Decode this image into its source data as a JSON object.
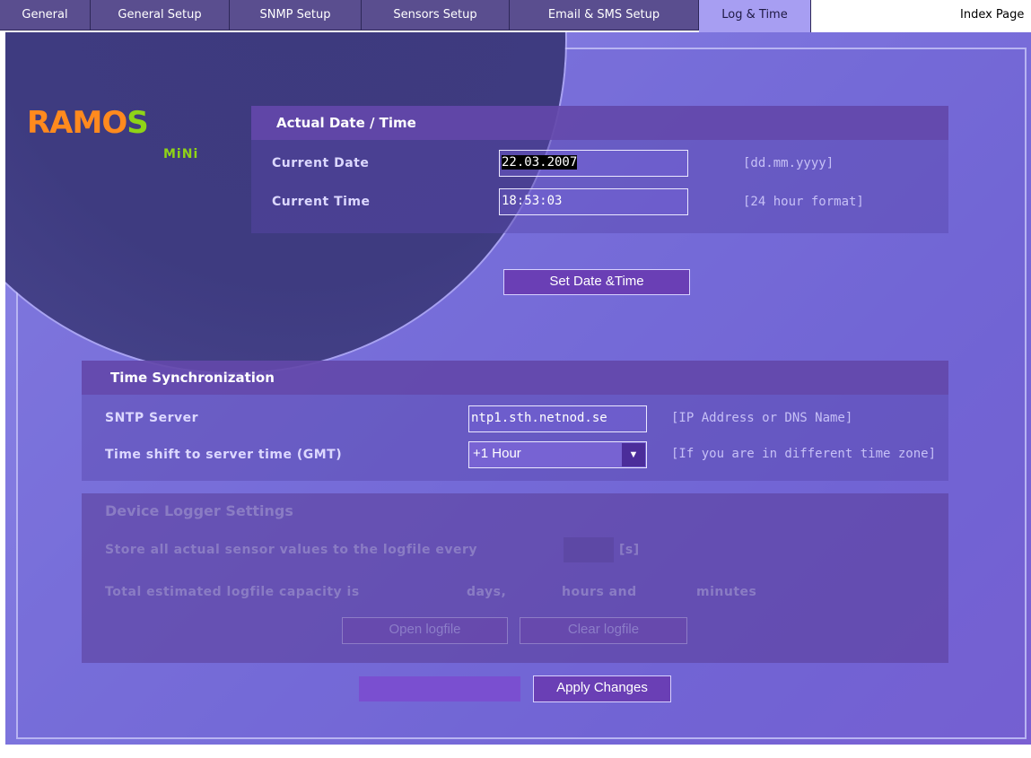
{
  "tabs": [
    {
      "label": "General",
      "active": false
    },
    {
      "label": "General Setup",
      "active": false
    },
    {
      "label": "SNMP Setup",
      "active": false
    },
    {
      "label": "Sensors Setup",
      "active": false
    },
    {
      "label": "Email & SMS Setup",
      "active": false
    },
    {
      "label": "Log & Time",
      "active": true
    }
  ],
  "index_link": "Index Page",
  "logo": {
    "main_part1": "RAMO",
    "main_part2": "S",
    "sub": "MiNi"
  },
  "datetime": {
    "title": "Actual Date / Time",
    "date_label": "Current Date",
    "date_value": "22.03.2007",
    "date_hint": "[dd.mm.yyyy]",
    "time_label": "Current Time",
    "time_value": "18:53:03",
    "time_hint": "[24 hour format]",
    "set_button": "Set Date &Time"
  },
  "sync": {
    "title": "Time Synchronization",
    "sntp_label": "SNTP Server",
    "sntp_value": "ntp1.sth.netnod.se",
    "sntp_hint": "[IP Address or  DNS Name]",
    "shift_label": "Time shift to server time (GMT)",
    "shift_value": "+1 Hour",
    "shift_hint": "[If you are in different time zone]"
  },
  "logger": {
    "title": "Device Logger Settings",
    "store_label": "Store all actual sensor values to the logfile every",
    "store_unit": "[s]",
    "capacity_label": "Total estimated logfile capacity is",
    "days": "days,",
    "hours": "hours and",
    "minutes": "minutes",
    "open_button": "Open logfile",
    "clear_button": "Clear logfile"
  },
  "apply_button": "Apply Changes",
  "colors": {
    "accent": "#6a3fb5",
    "logo_orange": "#ff8a1e",
    "logo_green": "#8fd417"
  }
}
